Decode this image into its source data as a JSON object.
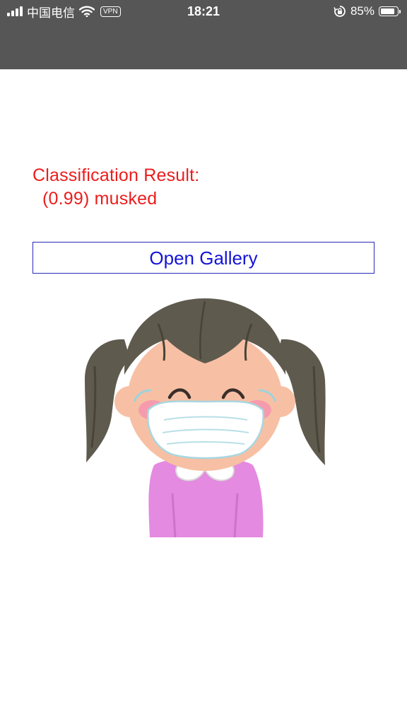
{
  "status_bar": {
    "carrier": "中国电信",
    "vpn": "VPN",
    "time": "18:21",
    "battery_percent_label": "85%",
    "battery_level": 0.85,
    "icons": [
      "signal-icon",
      "wifi-icon",
      "orientation-lock-icon",
      "battery-icon"
    ]
  },
  "result": {
    "heading": "Classification Result:",
    "value": "(0.99) musked",
    "color": "#ec1c1c"
  },
  "gallery_button": {
    "label": "Open Gallery",
    "color": "#1414d8"
  },
  "image": {
    "icon": "girl-wearing-mask-illustration"
  }
}
